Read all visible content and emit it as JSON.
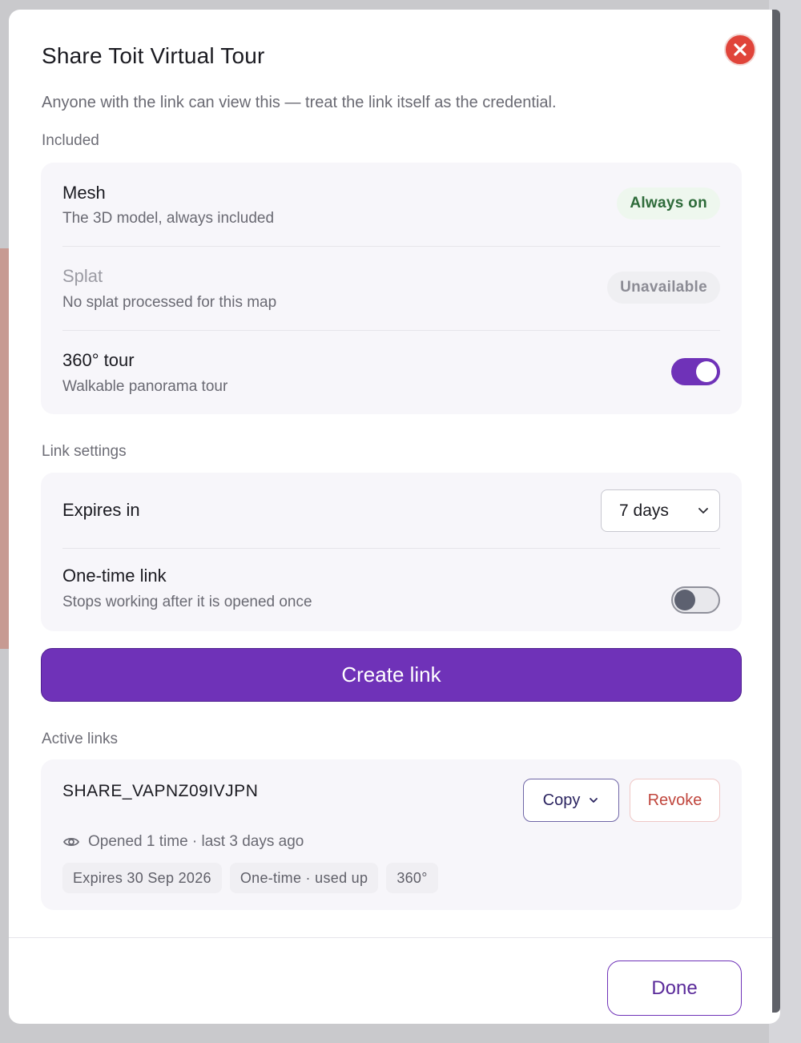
{
  "dialog": {
    "title": "Share Toit Virtual Tour",
    "subtitle": "Anyone with the link can view this — treat the link itself as the credential."
  },
  "included": {
    "label": "Included",
    "items": [
      {
        "title": "Mesh",
        "subtitle": "The 3D model, always included",
        "status": "Always on"
      },
      {
        "title": "Splat",
        "subtitle": "No splat processed for this map",
        "status": "Unavailable"
      },
      {
        "title": "360° tour",
        "subtitle": "Walkable panorama tour",
        "enabled": true
      }
    ]
  },
  "link_settings": {
    "label": "Link settings",
    "expires": {
      "title": "Expires in",
      "value": "7 days"
    },
    "one_time": {
      "title": "One-time link",
      "subtitle": "Stops working after it is opened once",
      "enabled": false
    }
  },
  "create_button": "Create link",
  "active_links": {
    "label": "Active links",
    "links": [
      {
        "code": "SHARE_VAPNZ09IVJPN",
        "copy_label": "Copy",
        "revoke_label": "Revoke",
        "opened_text": "Opened 1 time · last 3 days ago",
        "chips": [
          "Expires 30 Sep 2026",
          "One-time · used up",
          "360°"
        ]
      }
    ]
  },
  "done_button": "Done",
  "colors": {
    "accent": "#6f32b8",
    "close": "#e0443a",
    "success_text": "#2e6b3a",
    "danger_text": "#c0463d"
  },
  "icons": {
    "close": "close-icon",
    "chevron": "chevron-down-icon",
    "opened": "eye-icon"
  }
}
